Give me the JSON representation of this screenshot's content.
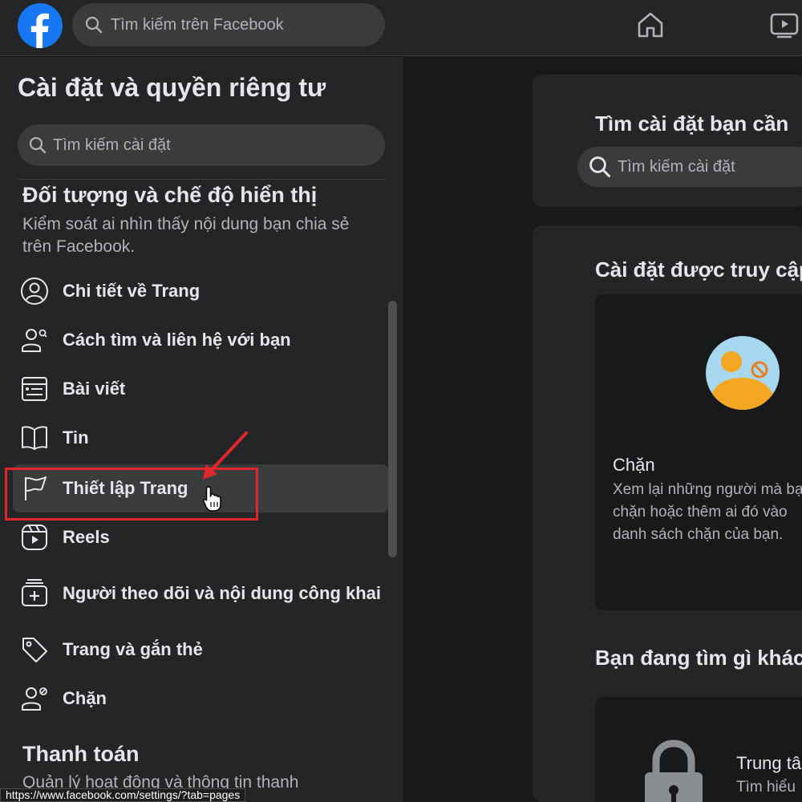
{
  "topbar": {
    "search_placeholder": "Tìm kiếm trên Facebook"
  },
  "sidebar": {
    "title": "Cài đặt và quyền riêng tư",
    "search_placeholder": "Tìm kiếm cài đặt",
    "section1": {
      "heading": "Đối tượng và chế độ hiển thị",
      "description": "Kiểm soát ai nhìn thấy nội dung bạn chia sẻ trên Facebook."
    },
    "items": [
      {
        "label": "Chi tiết về Trang",
        "icon": "profile-circle-icon"
      },
      {
        "label": "Cách tìm và liên hệ với bạn",
        "icon": "person-search-icon"
      },
      {
        "label": "Bài viết",
        "icon": "post-icon"
      },
      {
        "label": "Tin",
        "icon": "book-icon"
      },
      {
        "label": "Thiết lập Trang",
        "icon": "flag-icon",
        "active": true
      },
      {
        "label": "Reels",
        "icon": "reels-icon"
      },
      {
        "label": "Người theo dõi và nội dung công khai",
        "icon": "add-content-icon"
      },
      {
        "label": "Trang và gắn thẻ",
        "icon": "tag-icon"
      },
      {
        "label": "Chặn",
        "icon": "person-block-icon"
      }
    ],
    "section2": {
      "heading": "Thanh toán",
      "description": "Quản lý hoạt động và thông tin thanh"
    }
  },
  "main": {
    "search_card": {
      "title": "Tìm cài đặt bạn cần",
      "search_placeholder": "Tìm kiếm cài đặt"
    },
    "access_card": {
      "title": "Cài đặt được truy cập",
      "block": {
        "title": "Chặn",
        "description": "Xem lại những người mà bạn chặn hoặc thêm ai đó vào danh sách chặn của bạn."
      },
      "other_title": "Bạn đang tìm gì khác",
      "help": {
        "title": "Trung tâm",
        "description": "Tìm hiểu"
      }
    }
  },
  "status_url": "https://www.facebook.com/settings/?tab=pages",
  "colors": {
    "facebook_blue": "#1877f2",
    "highlight_red": "#e0262a"
  }
}
